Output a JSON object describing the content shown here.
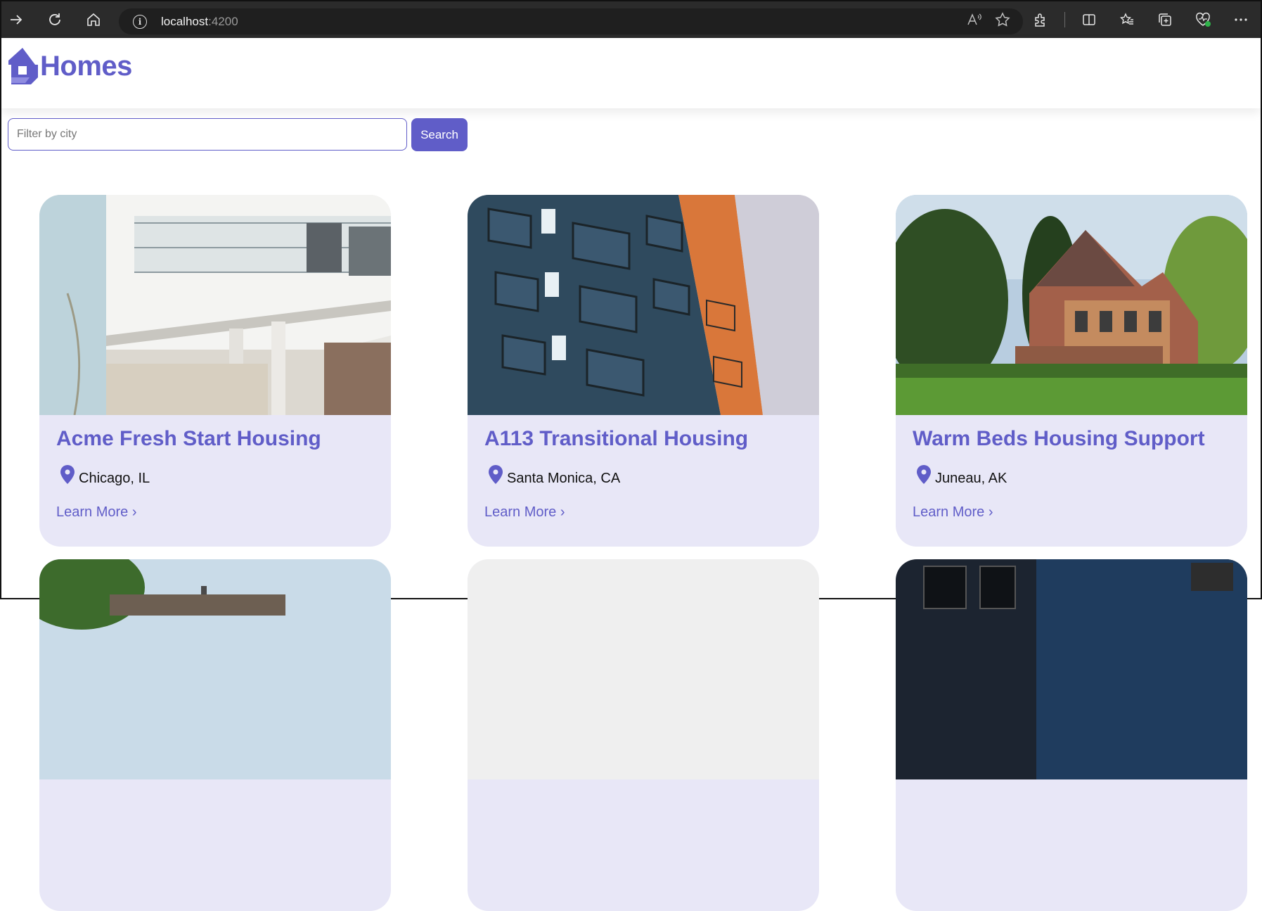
{
  "browser": {
    "url_host": "localhost",
    "url_port": ":4200"
  },
  "app": {
    "logo_text": "Homes",
    "brand_color": "#605DC8",
    "card_bg": "#E8E7F7"
  },
  "search": {
    "placeholder": "Filter by city",
    "value": "",
    "button_label": "Search"
  },
  "listings": [
    {
      "name": "Acme Fresh Start Housing",
      "location": "Chicago, IL",
      "link": "Learn More ›"
    },
    {
      "name": "A113 Transitional Housing",
      "location": "Santa Monica, CA",
      "link": "Learn More ›"
    },
    {
      "name": "Warm Beds Housing Support",
      "location": "Juneau, AK",
      "link": "Learn More ›"
    }
  ]
}
